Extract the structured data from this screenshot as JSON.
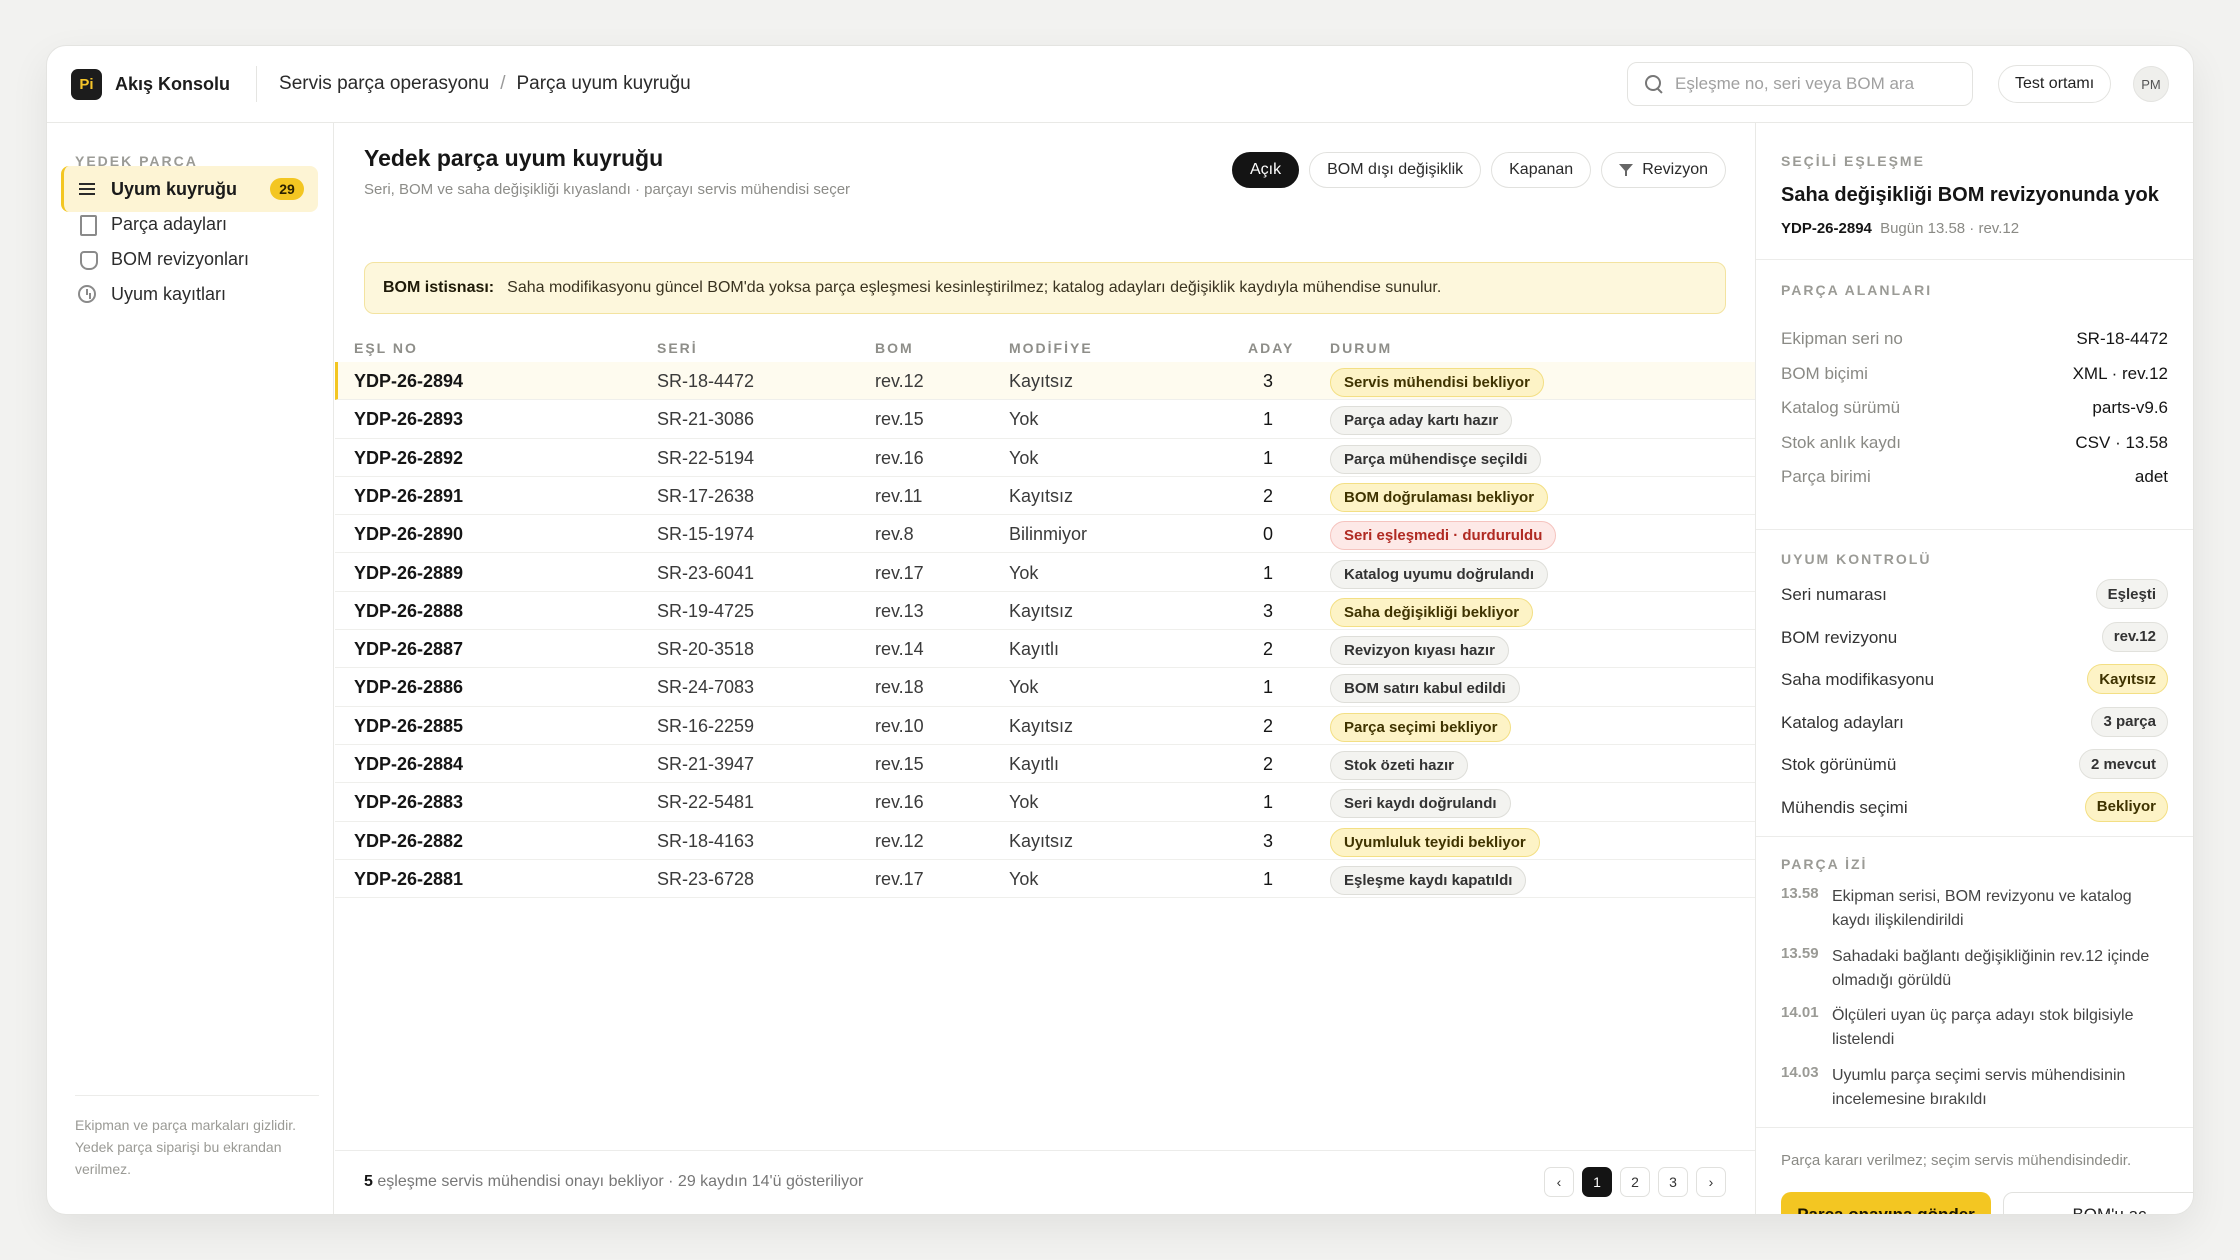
{
  "app": {
    "logo_text": "Pi",
    "name": "Akış Konsolu"
  },
  "breadcrumb": [
    "Servis parça operasyonu",
    "Parça uyum kuyruğu"
  ],
  "breadcrumb_sep": "/",
  "search": {
    "placeholder": "Eşleşme no, seri veya BOM ara"
  },
  "env_label": "Test ortamı",
  "avatar_initials": "PM",
  "sidebar": {
    "title": "YEDEK PARÇA",
    "items": [
      {
        "label": "Uyum kuyruğu",
        "icon": "list-icon",
        "count": "29",
        "active": true
      },
      {
        "label": "Parça adayları",
        "icon": "document-icon"
      },
      {
        "label": "BOM revizyonları",
        "icon": "shield-icon"
      },
      {
        "label": "Uyum kayıtları",
        "icon": "clock-icon"
      }
    ],
    "footer": "Ekipman ve parça markaları gizlidir. Yedek parça siparişi bu ekrandan verilmez."
  },
  "main": {
    "title": "Yedek parça uyum kuyruğu",
    "subtitle": "Seri, BOM ve saha değişikliği kıyaslandı · parçayı servis mühendisi seçer",
    "filters": [
      "Açık",
      "BOM dışı değişiklik",
      "Kapanan",
      "Revizyon"
    ],
    "banner": {
      "label": "BOM istisnası:",
      "text": "Saha modifikasyonu güncel BOM'da yoksa parça eşleşmesi kesinleştirilmez; katalog adayları değişiklik kaydıyla mühendise sunulur."
    },
    "columns": [
      "EŞL NO",
      "SERİ",
      "BOM",
      "MODİFİYE",
      "ADAY",
      "DURUM"
    ],
    "rows": [
      {
        "id": "YDP-26-2894",
        "seri": "SR-18-4472",
        "bom": "rev.12",
        "mod": "Kayıtsız",
        "aday": "3",
        "status": "Servis mühendisi bekliyor",
        "tone": "yellow"
      },
      {
        "id": "YDP-26-2893",
        "seri": "SR-21-3086",
        "bom": "rev.15",
        "mod": "Yok",
        "aday": "1",
        "status": "Parça aday kartı hazır",
        "tone": "grey"
      },
      {
        "id": "YDP-26-2892",
        "seri": "SR-22-5194",
        "bom": "rev.16",
        "mod": "Yok",
        "aday": "1",
        "status": "Parça mühendisçe seçildi",
        "tone": "grey"
      },
      {
        "id": "YDP-26-2891",
        "seri": "SR-17-2638",
        "bom": "rev.11",
        "mod": "Kayıtsız",
        "aday": "2",
        "status": "BOM doğrulaması bekliyor",
        "tone": "yellow"
      },
      {
        "id": "YDP-26-2890",
        "seri": "SR-15-1974",
        "bom": "rev.8",
        "mod": "Bilinmiyor",
        "aday": "0",
        "status": "Seri eşleşmedi · durduruldu",
        "tone": "red"
      },
      {
        "id": "YDP-26-2889",
        "seri": "SR-23-6041",
        "bom": "rev.17",
        "mod": "Yok",
        "aday": "1",
        "status": "Katalog uyumu doğrulandı",
        "tone": "grey"
      },
      {
        "id": "YDP-26-2888",
        "seri": "SR-19-4725",
        "bom": "rev.13",
        "mod": "Kayıtsız",
        "aday": "3",
        "status": "Saha değişikliği bekliyor",
        "tone": "yellow"
      },
      {
        "id": "YDP-26-2887",
        "seri": "SR-20-3518",
        "bom": "rev.14",
        "mod": "Kayıtlı",
        "aday": "2",
        "status": "Revizyon kıyası hazır",
        "tone": "grey"
      },
      {
        "id": "YDP-26-2886",
        "seri": "SR-24-7083",
        "bom": "rev.18",
        "mod": "Yok",
        "aday": "1",
        "status": "BOM satırı kabul edildi",
        "tone": "grey"
      },
      {
        "id": "YDP-26-2885",
        "seri": "SR-16-2259",
        "bom": "rev.10",
        "mod": "Kayıtsız",
        "aday": "2",
        "status": "Parça seçimi bekliyor",
        "tone": "yellow"
      },
      {
        "id": "YDP-26-2884",
        "seri": "SR-21-3947",
        "bom": "rev.15",
        "mod": "Kayıtlı",
        "aday": "2",
        "status": "Stok özeti hazır",
        "tone": "grey"
      },
      {
        "id": "YDP-26-2883",
        "seri": "SR-22-5481",
        "bom": "rev.16",
        "mod": "Yok",
        "aday": "1",
        "status": "Seri kaydı doğrulandı",
        "tone": "grey"
      },
      {
        "id": "YDP-26-2882",
        "seri": "SR-18-4163",
        "bom": "rev.12",
        "mod": "Kayıtsız",
        "aday": "3",
        "status": "Uyumluluk teyidi bekliyor",
        "tone": "yellow"
      },
      {
        "id": "YDP-26-2881",
        "seri": "SR-23-6728",
        "bom": "rev.17",
        "mod": "Yok",
        "aday": "1",
        "status": "Eşleşme kaydı kapatıldı",
        "tone": "grey"
      }
    ],
    "footer": {
      "count": "5",
      "text": "eşleşme servis mühendisi onayı bekliyor · 29 kaydın 14'ü gösteriliyor"
    },
    "pager": [
      "‹",
      "1",
      "2",
      "3",
      "›"
    ]
  },
  "panel": {
    "selected_label": "SEÇİLİ EŞLEŞME",
    "title": "Saha değişikliği BOM revizyonunda yok",
    "id": "YDP-26-2894",
    "meta": "Bugün 13.58 · rev.12",
    "fields_label": "PARÇA ALANLARI",
    "fields": [
      {
        "k": "Ekipman seri no",
        "v": "SR-18-4472"
      },
      {
        "k": "BOM biçimi",
        "v": "XML · rev.12"
      },
      {
        "k": "Katalog sürümü",
        "v": "parts-v9.6"
      },
      {
        "k": "Stok anlık kaydı",
        "v": "CSV · 13.58"
      },
      {
        "k": "Parça birimi",
        "v": "adet"
      }
    ],
    "checks_label": "UYUM KONTROLÜ",
    "checks": [
      {
        "k": "Seri numarası",
        "v": "Eşleşti",
        "tone": "grey"
      },
      {
        "k": "BOM revizyonu",
        "v": "rev.12",
        "tone": "grey"
      },
      {
        "k": "Saha modifikasyonu",
        "v": "Kayıtsız",
        "tone": "yellow"
      },
      {
        "k": "Katalog adayları",
        "v": "3 parça",
        "tone": "grey"
      },
      {
        "k": "Stok görünümü",
        "v": "2 mevcut",
        "tone": "grey"
      },
      {
        "k": "Mühendis seçimi",
        "v": "Bekliyor",
        "tone": "yellow"
      }
    ],
    "trace_label": "PARÇA İZİ",
    "trace": [
      {
        "t": "13.58",
        "d": "Ekipman serisi, BOM revizyonu ve katalog kaydı ilişkilendirildi"
      },
      {
        "t": "13.59",
        "d": "Sahadaki bağlantı değişikliğinin rev.12 içinde olmadığı görüldü"
      },
      {
        "t": "14.01",
        "d": "Ölçüleri uyan üç parça adayı stok bilgisiyle listelendi"
      },
      {
        "t": "14.03",
        "d": "Uyumlu parça seçimi servis mühendisinin incelemesine bırakıldı"
      }
    ],
    "note": "Parça kararı verilmez; seçim servis mühendisindedir.",
    "primary_button": "Parça onayına gönder",
    "secondary_button": "BOM'u aç"
  },
  "colors": {
    "accent": "#f3c622",
    "dark": "#141414",
    "warn_bg": "#fdf3c6",
    "error_text": "#b02a22"
  }
}
